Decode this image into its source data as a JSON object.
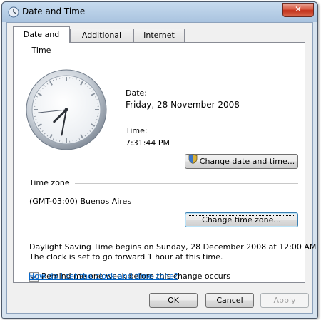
{
  "window": {
    "title": "Date and Time",
    "close_label": "✕"
  },
  "tabs": [
    {
      "label": "Date and Time",
      "active": true
    },
    {
      "label": "Additional Clocks",
      "active": false
    },
    {
      "label": "Internet Time",
      "active": false
    }
  ],
  "date": {
    "label": "Date:",
    "value": "Friday, 28 November 2008"
  },
  "time": {
    "label": "Time:",
    "value": "7:31:44 PM"
  },
  "change_datetime_button": "Change date and time...",
  "timezone": {
    "section_label": "Time zone",
    "value": "(GMT-03:00) Buenos Aires",
    "change_button": "Change time zone..."
  },
  "dst": {
    "line1": "Daylight Saving Time begins on Sunday, 28 December 2008 at 12:00 AM.",
    "line2": "The clock is set to go forward 1 hour at this time."
  },
  "reminder": {
    "label": "Remind me one week before this change occurs",
    "checked": true
  },
  "help_link": "How do I set the clock and time zone?",
  "footer": {
    "ok": "OK",
    "cancel": "Cancel",
    "apply": "Apply"
  },
  "colors": {
    "link": "#0066cc",
    "close_button": "#c2301a"
  }
}
